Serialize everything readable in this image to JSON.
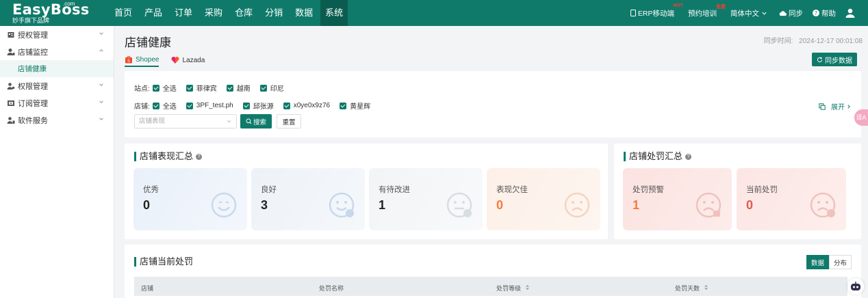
{
  "brand": {
    "name": "EasyBoss",
    "com": ".com",
    "sub": "妙手旗下品牌"
  },
  "nav": [
    "首页",
    "产品",
    "订单",
    "采购",
    "仓库",
    "分销",
    "数据",
    "系统"
  ],
  "nav_active": "系统",
  "top_right": {
    "erp_mobile": "ERP移动端",
    "erp_badge": "HOT",
    "training": "预约培训",
    "training_badge": "免费",
    "language": "简体中文",
    "sync": "同步",
    "help": "帮助"
  },
  "sidebar": [
    {
      "label": "授权管理",
      "icon": "auth-icon",
      "expanded": false
    },
    {
      "label": "店铺监控",
      "icon": "shop-monitor-icon",
      "expanded": true
    },
    {
      "label": "店铺健康",
      "sub": true
    },
    {
      "label": "权限管理",
      "icon": "permission-icon",
      "expanded": false
    },
    {
      "label": "订阅管理",
      "icon": "subscription-icon",
      "expanded": false
    },
    {
      "label": "软件服务",
      "icon": "software-icon",
      "expanded": false
    }
  ],
  "page": {
    "title": "店铺健康",
    "sync_time_label": "同步时间:",
    "sync_time": "2024-12-17 00:01:08",
    "sync_button": "同步数据"
  },
  "platform_tabs": [
    {
      "label": "Shopee",
      "active": true
    },
    {
      "label": "Lazada",
      "active": false
    }
  ],
  "filters": {
    "site_label": "站点:",
    "sites": [
      "全选",
      "菲律宾",
      "越南",
      "印尼"
    ],
    "store_label": "店铺:",
    "stores": [
      "全选",
      "3PF_test.ph",
      "邱张源",
      "x0ye0x9z76",
      "黄星辉"
    ],
    "expand": "展开",
    "select_placeholder": "店铺表现",
    "search": "搜索",
    "reset": "重置"
  },
  "performance": {
    "title": "店铺表现汇总",
    "cards": [
      {
        "label": "优秀",
        "value": "0"
      },
      {
        "label": "良好",
        "value": "3"
      },
      {
        "label": "有待改进",
        "value": "1"
      },
      {
        "label": "表现欠佳",
        "value": "0"
      }
    ]
  },
  "penalty": {
    "title": "店铺处罚汇总",
    "cards": [
      {
        "label": "处罚预警",
        "value": "1"
      },
      {
        "label": "当前处罚",
        "value": "0"
      }
    ]
  },
  "current_penalty": {
    "title": "店铺当前处罚",
    "switch": [
      "数据",
      "分布"
    ],
    "columns": [
      "店铺",
      "处罚名称",
      "处罚等级",
      "处罚天数"
    ]
  },
  "colors": {
    "primary": "#0f7a6a",
    "warn": "#f57c3a",
    "danger": "#e05a4e"
  },
  "floating": {
    "translate": "译A"
  }
}
